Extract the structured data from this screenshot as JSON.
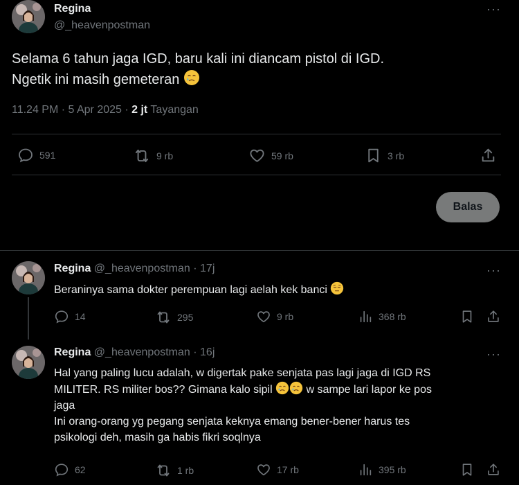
{
  "main_tweet": {
    "name": "Regina",
    "handle": "@_heavenpostman",
    "text_line1": "Selama 6 tahun jaga IGD, baru kali ini diancam pistol di IGD.",
    "text_line2": "Ngetik ini masih gemeteran",
    "timestamp": "11.24 PM · 5 Apr 2025 · ",
    "views_count": "2 jt",
    "views_label": " Tayangan",
    "stats": {
      "replies": "591",
      "retweets": "9 rb",
      "likes": "59 rb",
      "bookmarks": "3 rb"
    }
  },
  "reply_button_label": "Balas",
  "replies": [
    {
      "name": "Regina",
      "handle": "@_heavenpostman",
      "time": "17j",
      "text": "Beraninya sama dokter perempuan lagi aelah kek banci",
      "stats": {
        "replies": "14",
        "retweets": "295",
        "likes": "9 rb",
        "views": "368 rb"
      }
    },
    {
      "name": "Regina",
      "handle": "@_heavenpostman",
      "time": "16j",
      "line1": "Hal yang paling lucu adalah, w digertak pake senjata pas lagi jaga di IGD RS",
      "line2a": "MILITER. RS militer bos?? Gimana kalo sipil ",
      "line2b": " w sampe lari lapor ke pos",
      "line3": "jaga",
      "line4": "Ini orang-orang yg pegang senjata keknya emang bener-bener harus tes",
      "line5": "psikologi deh, masih ga habis fikri soqlnya",
      "stats": {
        "replies": "62",
        "retweets": "1 rb",
        "likes": "17 rb",
        "views": "395 rb"
      }
    }
  ],
  "colors": {
    "background": "#000000",
    "text": "#e7e9ea",
    "muted": "#71767b",
    "divider": "#2f3336",
    "button": "#787a7a"
  },
  "icons": [
    "more-icon",
    "reply-icon",
    "retweet-icon",
    "like-icon",
    "bookmark-icon",
    "share-icon",
    "views-icon",
    "crying-emoji",
    "pensive-emoji"
  ]
}
